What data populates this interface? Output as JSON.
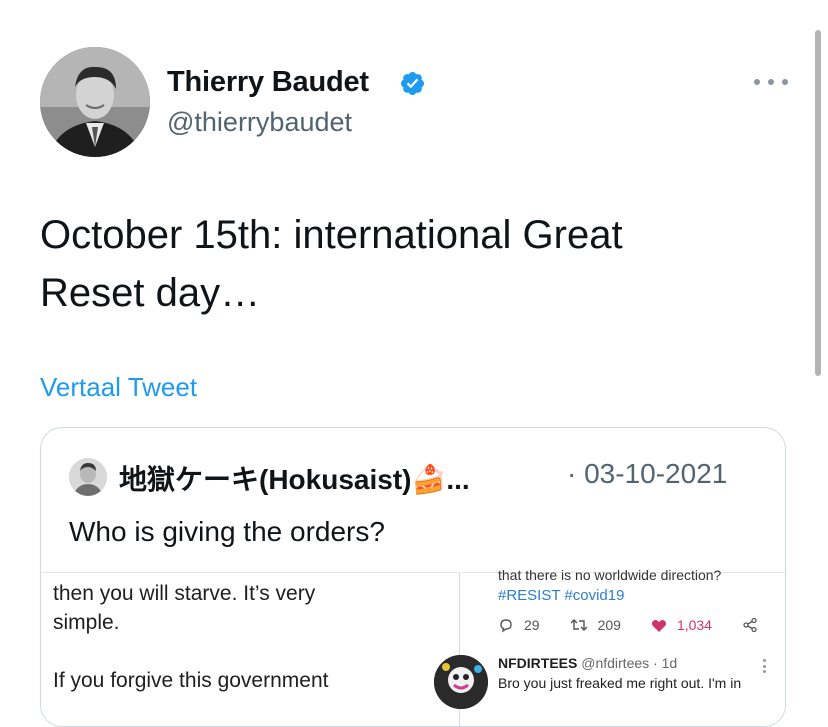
{
  "author": {
    "name": "Thierry Baudet",
    "handle": "@thierrybaudet"
  },
  "tweet": {
    "text_line1": "October 15th: international Great",
    "text_line2": "Reset day…",
    "translate_label": "Vertaal Tweet"
  },
  "quoted": {
    "name": "地獄ケーキ(Hokusaist)🍰...",
    "separator": "·",
    "date": "03-10-2021",
    "text": "Who is giving the orders?"
  },
  "media": {
    "left_line1": "then you will starve. It’s very",
    "left_line2": "simple.",
    "left_line3": "If you forgive this government",
    "right_cut": "that there is no worldwide direction?",
    "right_tags": "#RESIST #covid19",
    "replies": "29",
    "retweets": "209",
    "likes": "1,034",
    "reply_name": "NFDIRTEES",
    "reply_handle": "@nfdirtees · 1d",
    "reply_text": "Bro you just freaked me right out. I'm in"
  },
  "colors": {
    "accent": "#1d9bf0",
    "text": "#0f1419",
    "secondary": "#536471",
    "like": "#d0336c"
  }
}
